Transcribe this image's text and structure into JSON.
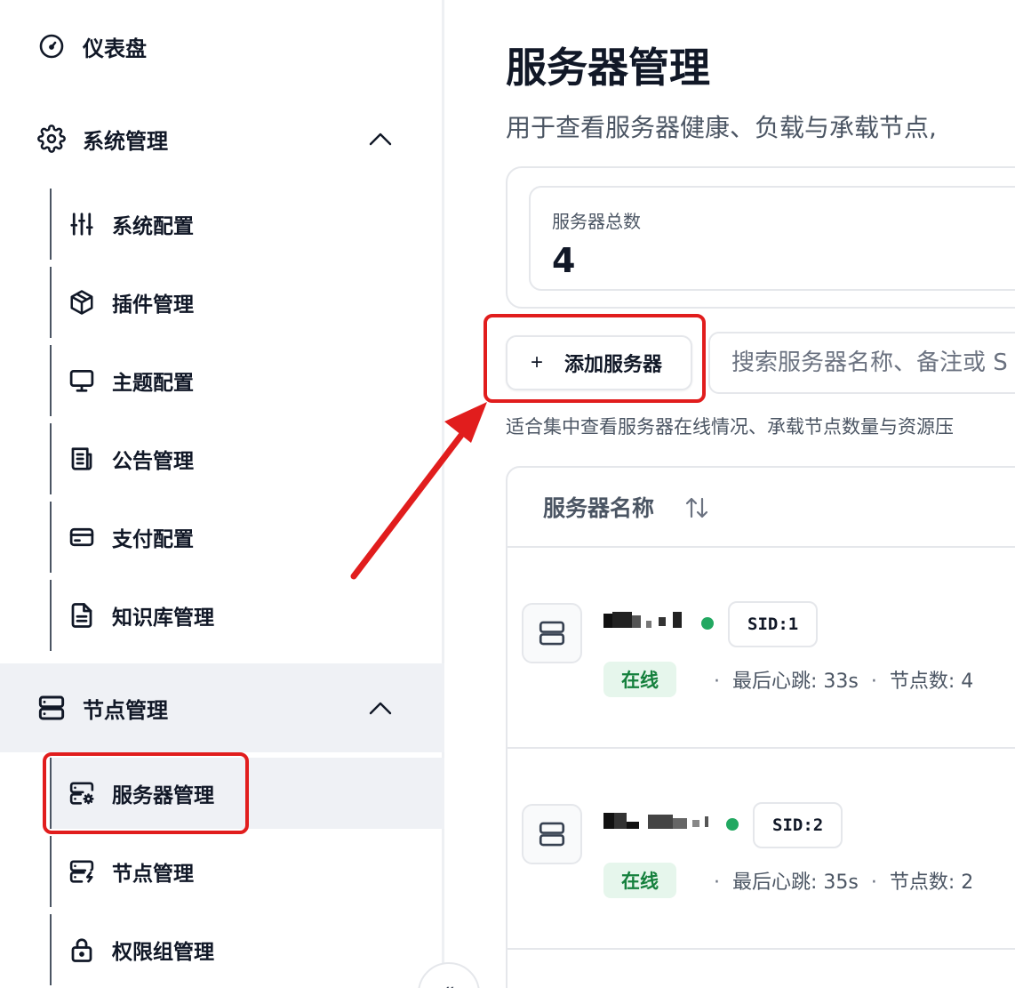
{
  "sidebar": {
    "dashboard": {
      "label": "仪表盘",
      "icon": "gauge-icon"
    },
    "system": {
      "label": "系统管理",
      "icon": "gear-icon",
      "items": [
        {
          "label": "系统配置",
          "icon": "sliders-icon"
        },
        {
          "label": "插件管理",
          "icon": "package-icon"
        },
        {
          "label": "主题配置",
          "icon": "monitor-icon"
        },
        {
          "label": "公告管理",
          "icon": "newspaper-icon"
        },
        {
          "label": "支付配置",
          "icon": "credit-card-icon"
        },
        {
          "label": "知识库管理",
          "icon": "file-text-icon"
        }
      ]
    },
    "nodes": {
      "label": "节点管理",
      "icon": "server-icon",
      "items": [
        {
          "label": "服务器管理",
          "icon": "server-cog-icon",
          "active": true
        },
        {
          "label": "节点管理",
          "icon": "server-bolt-icon"
        },
        {
          "label": "权限组管理",
          "icon": "lock-icon"
        }
      ]
    },
    "collapse_glyph": "«"
  },
  "main": {
    "title": "服务器管理",
    "description": "用于查看服务器健康、负载与承载节点,",
    "stats": {
      "label": "服务器总数",
      "value": "4"
    },
    "add_button": {
      "plus": "+",
      "label": "添加服务器"
    },
    "search": {
      "placeholder": "搜索服务器名称、备注或 S"
    },
    "hint": "适合集中查看服务器在线情况、承载节点数量与资源压",
    "table": {
      "header": "服务器名称",
      "rows": [
        {
          "sid": "SID:1",
          "status": "在线",
          "heartbeat": "最后心跳: 33s",
          "nodes": "节点数: 4"
        },
        {
          "sid": "SID:2",
          "status": "在线",
          "heartbeat": "最后心跳: 35s",
          "nodes": "节点数: 2"
        }
      ]
    }
  },
  "colors": {
    "accent_red": "#e11d1d",
    "online_green": "#22a861",
    "active_bg": "#eff1f5"
  }
}
